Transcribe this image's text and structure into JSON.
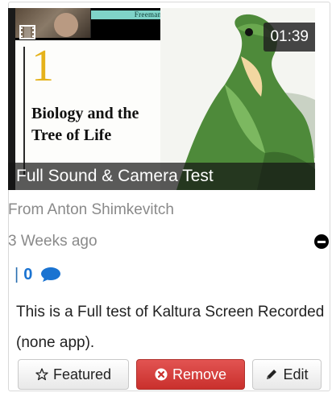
{
  "card": {
    "duration": "01:39",
    "title": "Full Sound & Camera Test",
    "from": "From Anton Shimkevitch",
    "time_ago": "3 Weeks ago",
    "separator": "|",
    "comment_count": "0",
    "description": "This is a Full test of Kaltura Screen Recorded (none app)."
  },
  "thumbnail_slide": {
    "authors": "Freeman  Quillin  Allison",
    "chapter_number": "1",
    "chapter_title": "Biology and the Tree of Life"
  },
  "actions": {
    "featured_label": "Featured",
    "remove_label": "Remove",
    "edit_label": "Edit"
  },
  "icons": {
    "media_type": "film-icon",
    "delete": "minus-circle-icon",
    "comments": "chat-bubble-icon",
    "featured": "star-outline-icon",
    "remove": "times-circle-icon",
    "edit": "pencil-icon"
  },
  "colors": {
    "remove_button": "#d9534f",
    "comment_accent": "#1a73d1",
    "meta_text": "#8a8a8a"
  }
}
